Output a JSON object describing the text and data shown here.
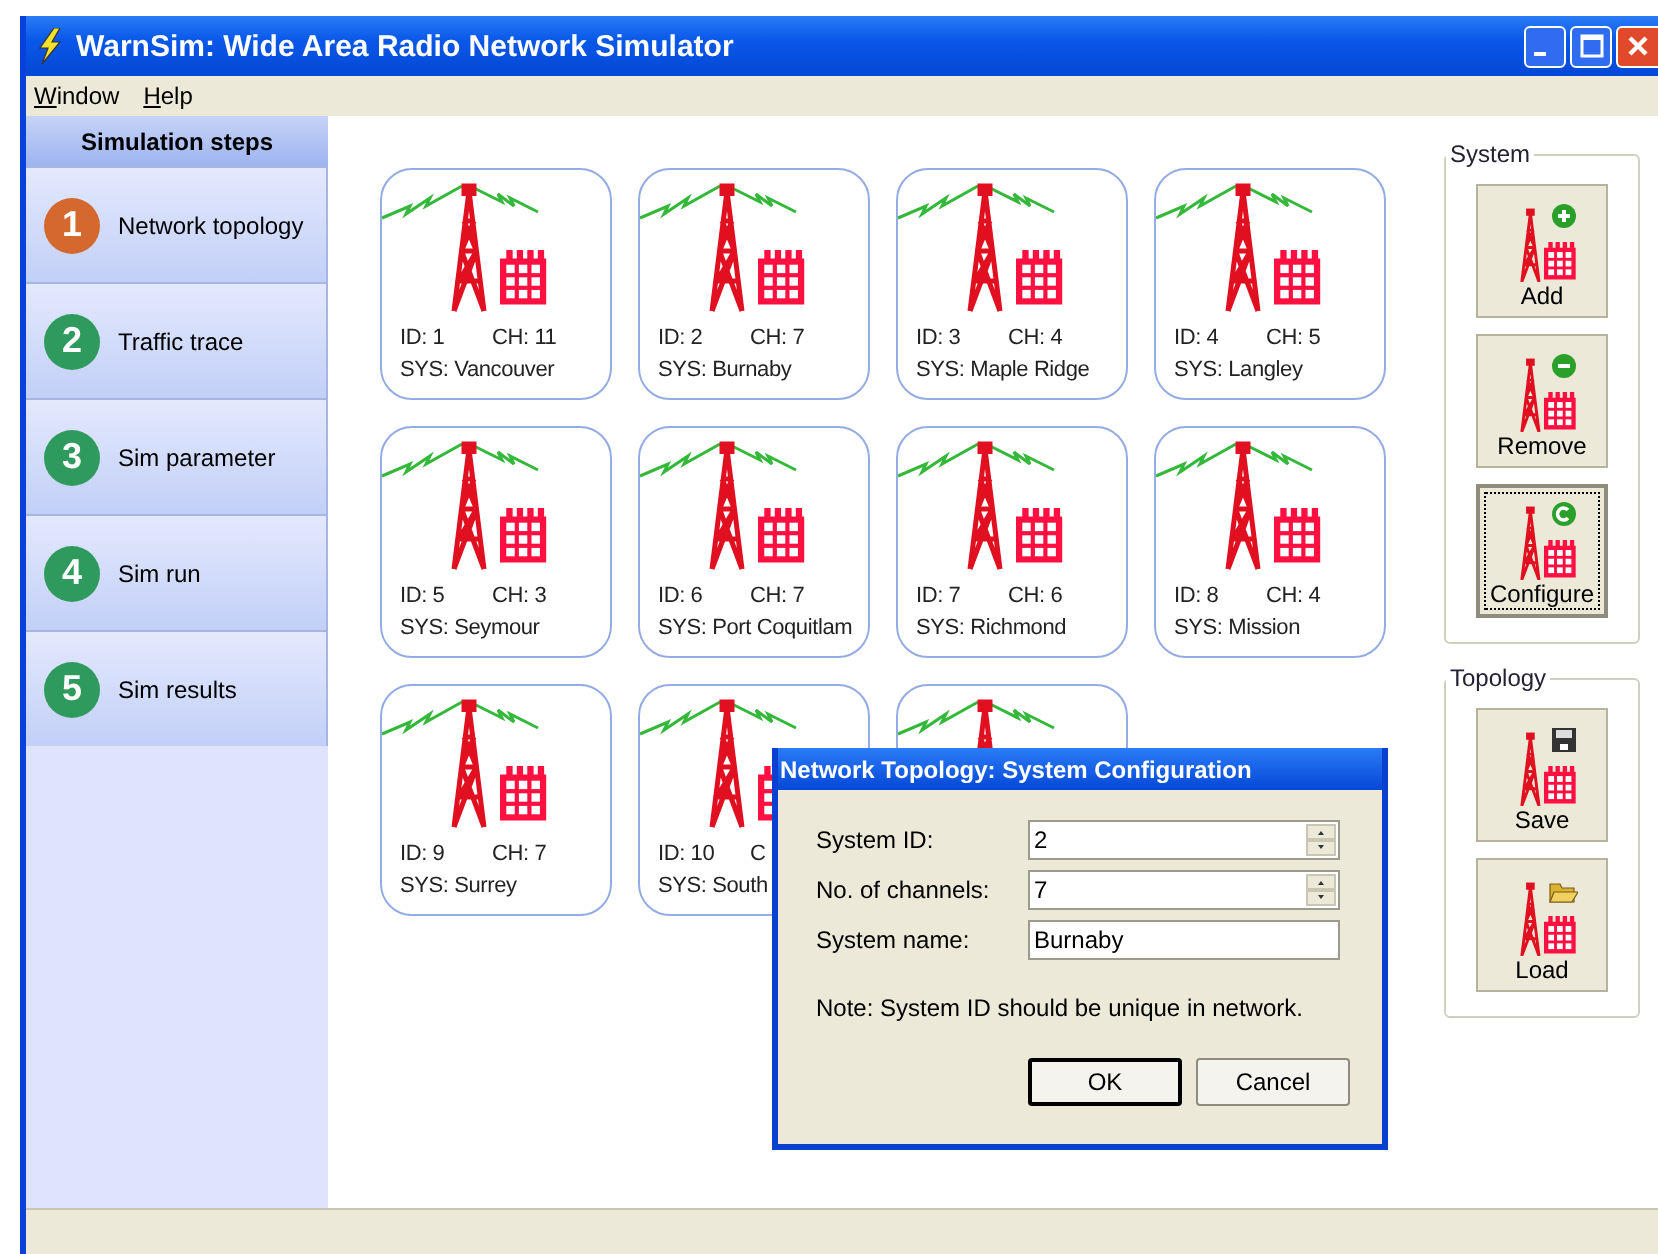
{
  "window": {
    "title": "WarnSim: Wide Area Radio Network Simulator"
  },
  "menu": [
    "Window",
    "Help"
  ],
  "sidebar": {
    "title": "Simulation steps",
    "steps": [
      {
        "number": "1",
        "label": "Network topology",
        "selected": true
      },
      {
        "number": "2",
        "label": "Traffic trace",
        "selected": false
      },
      {
        "number": "3",
        "label": "Sim parameter",
        "selected": false
      },
      {
        "number": "4",
        "label": "Sim run",
        "selected": false
      },
      {
        "number": "5",
        "label": "Sim results",
        "selected": false
      }
    ]
  },
  "systems": [
    {
      "kind": "system",
      "id": "ID: 1",
      "ch": "CH: 11",
      "sys": "SYS: Vancouver"
    },
    {
      "kind": "system",
      "id": "ID: 2",
      "ch": "CH: 7",
      "sys": "SYS: Burnaby"
    },
    {
      "kind": "system",
      "id": "ID: 3",
      "ch": "CH: 4",
      "sys": "SYS: Maple Ridge"
    },
    {
      "kind": "system",
      "id": "ID: 4",
      "ch": "CH: 5",
      "sys": "SYS: Langley"
    },
    {
      "kind": "system",
      "id": "ID: 5",
      "ch": "CH: 3",
      "sys": "SYS: Seymour"
    },
    {
      "kind": "system",
      "id": "ID: 6",
      "ch": "CH: 7",
      "sys": "SYS: Port Coquitlam"
    },
    {
      "kind": "system",
      "id": "ID: 7",
      "ch": "CH: 6",
      "sys": "SYS: Richmond"
    },
    {
      "kind": "system",
      "id": "ID: 8",
      "ch": "CH: 4",
      "sys": "SYS: Mission"
    },
    {
      "kind": "system",
      "id": "ID: 9",
      "ch": "CH: 7",
      "sys": "SYS: Surrey"
    },
    {
      "kind": "system",
      "id": "ID: 10",
      "ch": "C",
      "sys": "SYS: South"
    },
    {
      "kind": "covered"
    }
  ],
  "system_group": {
    "title": "System",
    "buttons": [
      {
        "label": "Add",
        "kind": "add",
        "focused": false
      },
      {
        "label": "Remove",
        "kind": "remove",
        "focused": false
      },
      {
        "label": "Configure",
        "kind": "configure",
        "focused": true
      }
    ]
  },
  "topology_group": {
    "title": "Topology",
    "buttons": [
      {
        "label": "Save",
        "kind": "save",
        "focused": false
      },
      {
        "label": "Load",
        "kind": "load",
        "focused": false
      }
    ]
  },
  "dialog": {
    "title": "Network Topology: System Configuration",
    "fields": [
      {
        "label": "System ID:",
        "value": "2",
        "kind": "spinner"
      },
      {
        "label": "No. of channels:",
        "value": "7",
        "kind": "spinner"
      },
      {
        "label": "System name:",
        "value": "Burnaby",
        "kind": "text"
      }
    ],
    "note": "Note: System ID should be unique in network.",
    "buttons": [
      {
        "label": "OK",
        "default": true
      },
      {
        "label": "Cancel",
        "default": false
      }
    ]
  }
}
